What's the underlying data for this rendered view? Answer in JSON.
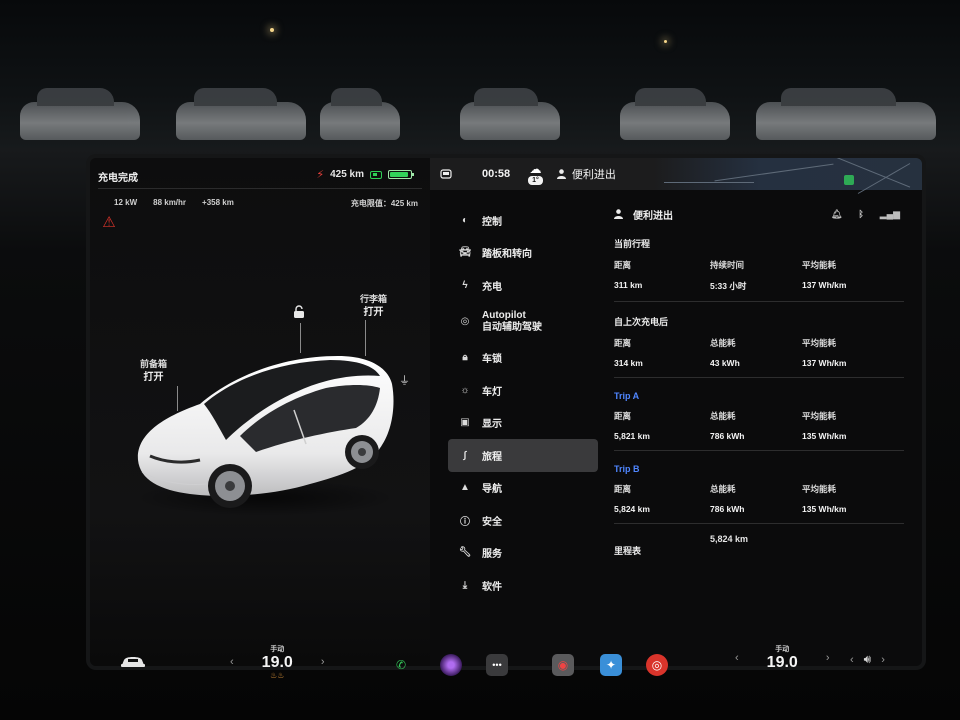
{
  "car_panel": {
    "title": "充电完成",
    "range": "425 km",
    "charge_stats": [
      "12 kW",
      "88 km/hr",
      "+358 km"
    ],
    "charge_limit": "充电限值：425 km",
    "frunk_label": "前备箱",
    "frunk_state": "打开",
    "trunk_label": "行李箱",
    "trunk_state": "打开",
    "battery_level": 0.92
  },
  "topbar": {
    "time": "00:58",
    "temperature": "1°",
    "profile": "便利进出"
  },
  "menu": {
    "items": [
      {
        "label": "控制",
        "icon": "toggle-icon"
      },
      {
        "label": "踏板和转向",
        "icon": "car-icon"
      },
      {
        "label": "充电",
        "icon": "bolt-icon"
      },
      {
        "label": "Autopilot",
        "label2": "自动辅助驾驶",
        "icon": "steering-wheel-icon"
      },
      {
        "label": "车锁",
        "icon": "lock-icon"
      },
      {
        "label": "车灯",
        "icon": "sun-icon"
      },
      {
        "label": "显示",
        "icon": "display-icon"
      },
      {
        "label": "旅程",
        "icon": "trip-icon",
        "active": true
      },
      {
        "label": "导航",
        "icon": "navigation-icon"
      },
      {
        "label": "安全",
        "icon": "info-icon"
      },
      {
        "label": "服务",
        "icon": "wrench-icon"
      },
      {
        "label": "软件",
        "icon": "download-icon"
      }
    ]
  },
  "trips": {
    "header": "便利进出",
    "current": {
      "title": "当前行程",
      "h1": "距离",
      "h2": "持续时间",
      "h3": "平均能耗",
      "v1": "311 km",
      "v2": "5:33 小时",
      "v3": "137 Wh/km"
    },
    "since_charge": {
      "title": "自上次充电后",
      "h1": "距离",
      "h2": "总能耗",
      "h3": "平均能耗",
      "v1": "314 km",
      "v2": "43 kWh",
      "v3": "137 Wh/km"
    },
    "trip_a": {
      "title": "Trip A",
      "h1": "距离",
      "h2": "总能耗",
      "h3": "平均能耗",
      "v1": "5,821 km",
      "v2": "786 kWh",
      "v3": "135 Wh/km"
    },
    "trip_b": {
      "title": "Trip B",
      "h1": "距离",
      "h2": "总能耗",
      "h3": "平均能耗",
      "v1": "5,824 km",
      "v2": "786 kWh",
      "v3": "135 Wh/km"
    },
    "odometer_label": "里程表",
    "odometer_value": "5,824 km"
  },
  "dock": {
    "left_mode": "手动",
    "left_temp": "19.0",
    "right_mode": "手动",
    "right_temp": "19.0"
  },
  "colors": {
    "accent_blue": "#4f86ff",
    "charge_green": "#32d35a",
    "alert_red": "#d9342b"
  }
}
